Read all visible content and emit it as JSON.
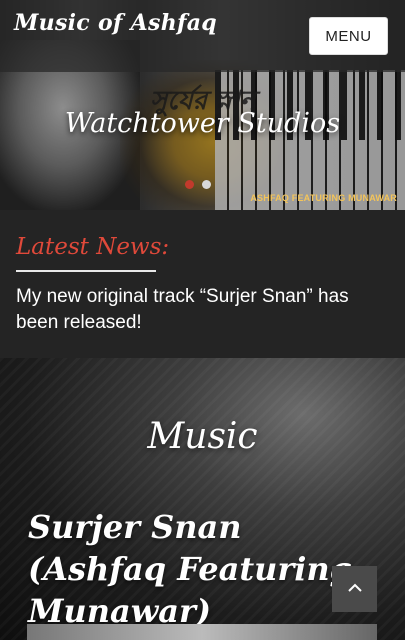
{
  "site": {
    "title": "Music of Ashfaq",
    "menu_label": "MENU"
  },
  "hero": {
    "title": "Watchtower Studios",
    "caption": "ASHFAQ FEATURING MUNAWAR",
    "art_text": "সুর্যের স্নান",
    "slides": {
      "count": 2,
      "active": 0
    }
  },
  "news": {
    "heading": "Latest News:",
    "text": "My new original track “Surjer Snan” has been released!"
  },
  "music": {
    "heading": "Music",
    "song_title": "Surjer Snan (Ashfaq Featuring Munawar)"
  },
  "colors": {
    "accent": "#e0493a",
    "dot_active": "#c23a2c",
    "caption": "#f3c45a"
  },
  "icons": {
    "scroll_top": "chevron-up-icon"
  }
}
